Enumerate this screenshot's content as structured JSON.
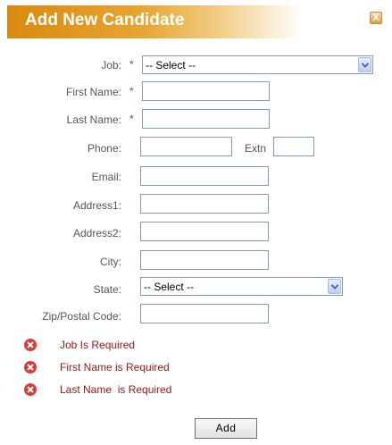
{
  "header": {
    "title": "Add New Candidate",
    "close_label": "X"
  },
  "form": {
    "job": {
      "label": "Job:",
      "required_mark": "*",
      "selected": "-- Select --"
    },
    "first_name": {
      "label": "First Name:",
      "required_mark": "*",
      "value": ""
    },
    "last_name": {
      "label": "Last Name:",
      "required_mark": "*",
      "value": ""
    },
    "phone": {
      "label": "Phone:",
      "value": "",
      "extn_label": "Extn",
      "extn_value": ""
    },
    "email": {
      "label": "Email:",
      "value": ""
    },
    "address1": {
      "label": "Address1:",
      "value": ""
    },
    "address2": {
      "label": "Address2:",
      "value": ""
    },
    "city": {
      "label": "City:",
      "value": ""
    },
    "state": {
      "label": "State:",
      "selected": "-- Select --"
    },
    "zip": {
      "label": "Zip/Postal Code:",
      "value": ""
    }
  },
  "errors": [
    {
      "text": "Job Is Required",
      "icon": "error-x-icon"
    },
    {
      "text": "First Name is Required",
      "icon": "error-x-icon"
    },
    {
      "text": "Last Name  is Required",
      "icon": "error-x-icon"
    }
  ],
  "actions": {
    "add_label": "Add"
  },
  "colors": {
    "header_orange": "#d98a10",
    "error_text": "#9a1414",
    "error_icon": "#d93b35",
    "input_border": "#7f9db9"
  }
}
